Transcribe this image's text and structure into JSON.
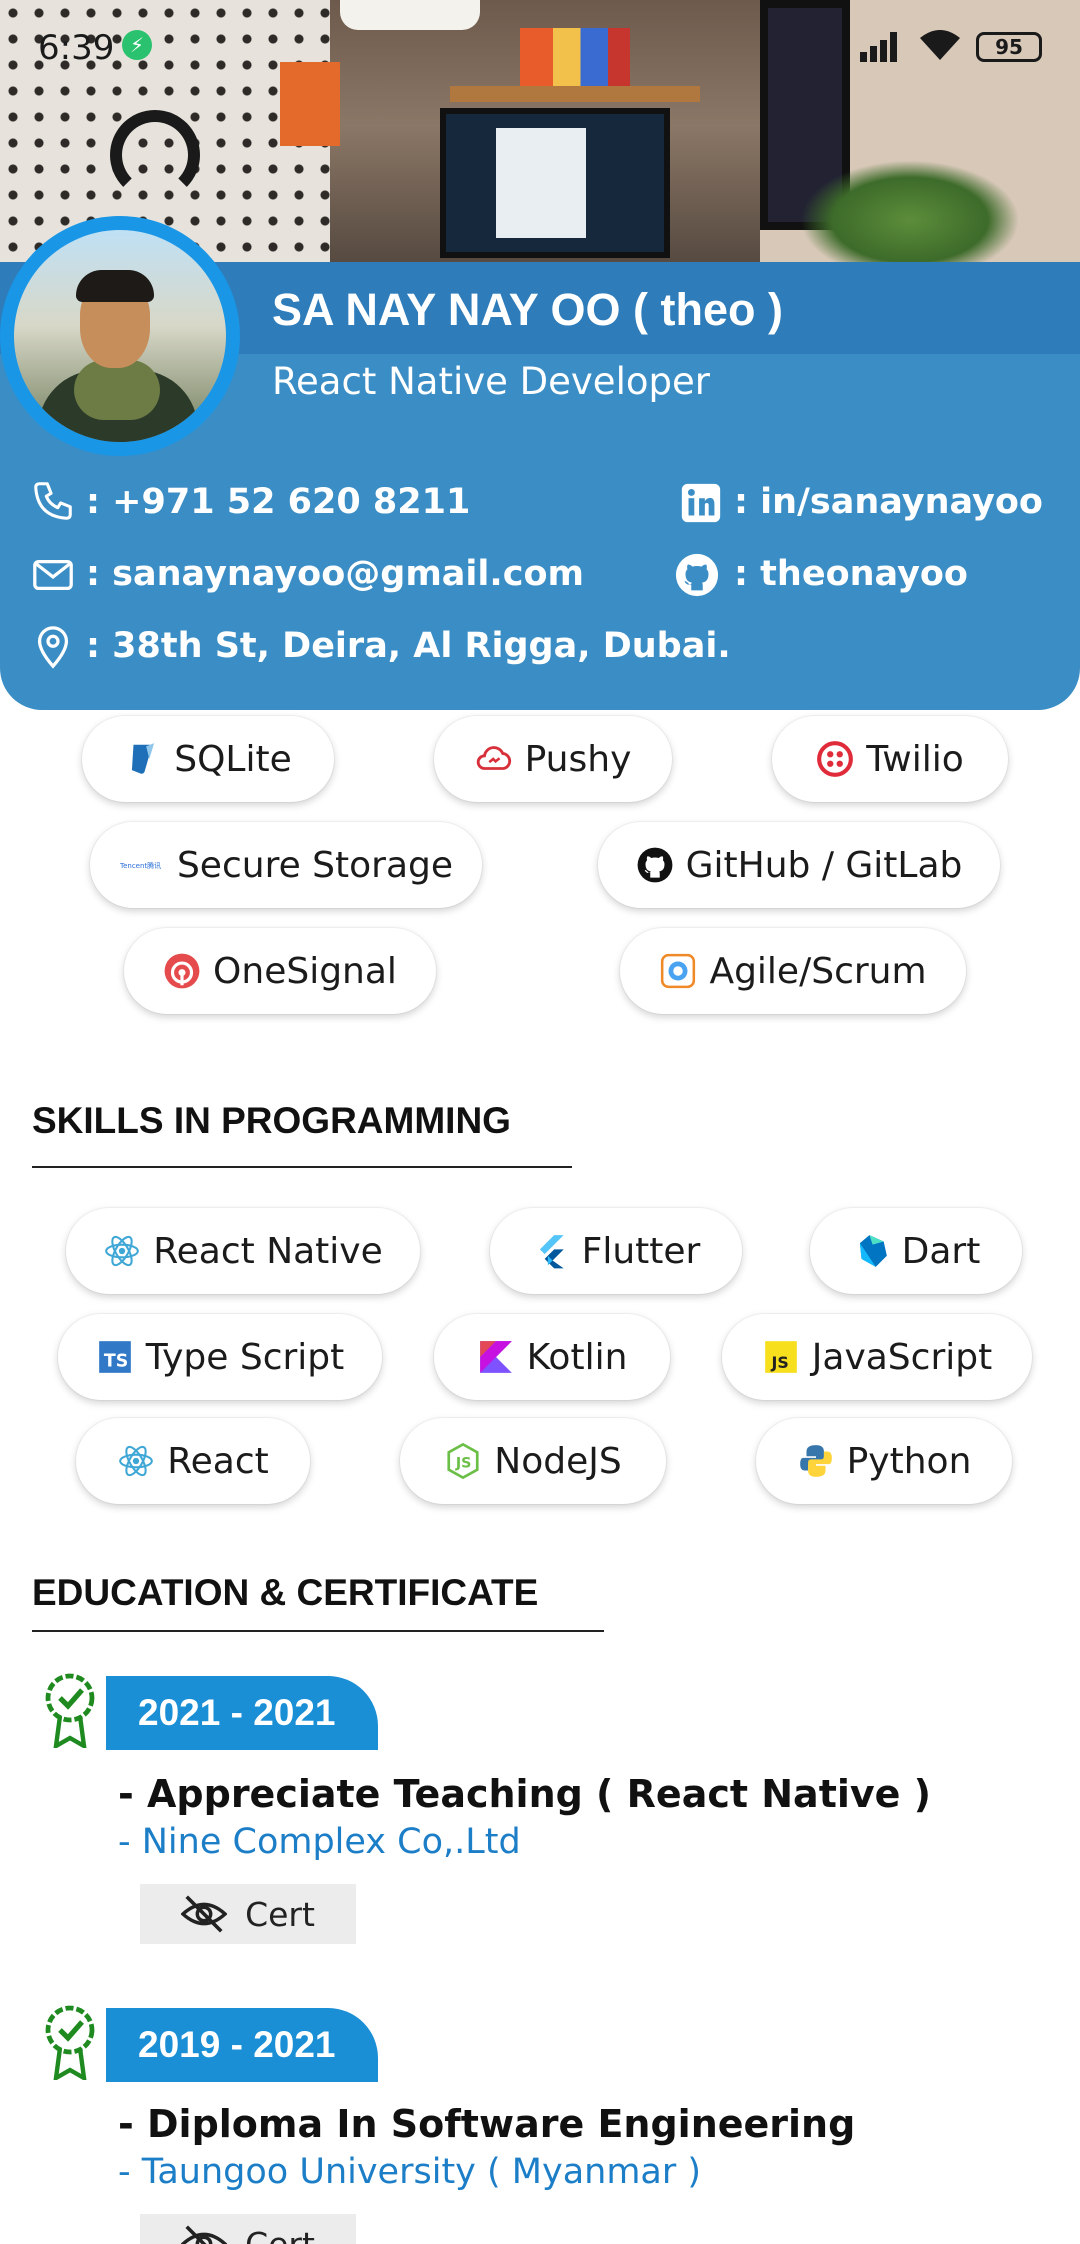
{
  "status_bar": {
    "time": "6:39",
    "battery": "95"
  },
  "profile": {
    "name": "SA NAY NAY OO ( theo )",
    "role": "React Native Developer",
    "phone": ": +971 52 620 8211",
    "linkedin": ": in/sanaynayoo",
    "email": ": sanaynayoo@gmail.com",
    "github": ": theonayoo",
    "address": ": 38th St, Deira, Al Rigga, Dubai."
  },
  "tools": [
    {
      "label": "SQLite",
      "icon": "sqlite-icon"
    },
    {
      "label": "Pushy",
      "icon": "pushy-cloud-icon"
    },
    {
      "label": "Twilio",
      "icon": "twilio-icon"
    },
    {
      "label": "Secure Storage",
      "icon": "tencent-icon"
    },
    {
      "label": "GitHub / GitLab",
      "icon": "github-icon"
    },
    {
      "label": "OneSignal",
      "icon": "onesignal-icon"
    },
    {
      "label": "Agile/Scrum",
      "icon": "agile-icon"
    }
  ],
  "skills": {
    "heading": "SKILLS IN PROGRAMMING",
    "items": [
      {
        "label": "React Native",
        "icon": "react-icon"
      },
      {
        "label": "Flutter",
        "icon": "flutter-icon"
      },
      {
        "label": "Dart",
        "icon": "dart-icon"
      },
      {
        "label": "Type Script",
        "icon": "typescript-icon"
      },
      {
        "label": "Kotlin",
        "icon": "kotlin-icon"
      },
      {
        "label": "JavaScript",
        "icon": "javascript-icon"
      },
      {
        "label": "React",
        "icon": "react-icon"
      },
      {
        "label": "NodeJS",
        "icon": "nodejs-icon"
      },
      {
        "label": "Python",
        "icon": "python-icon"
      }
    ]
  },
  "education": {
    "heading": "EDUCATION & CERTIFICATE",
    "entries": [
      {
        "years": "2021 - 2021",
        "title": "- Appreciate Teaching ( React Native )",
        "org": "- Nine Complex Co,.Ltd",
        "cert_label": "Cert"
      },
      {
        "years": "2019 - 2021",
        "title": "- Diploma In Software Engineering",
        "org": "- Taungoo University ( Myanmar )",
        "cert_label": "Cert"
      }
    ]
  },
  "colors": {
    "card_blue": "#3b8ec5",
    "accent_blue": "#1a8fd6",
    "link_blue": "#1d7ec8",
    "award_green": "#1f8a1f"
  }
}
